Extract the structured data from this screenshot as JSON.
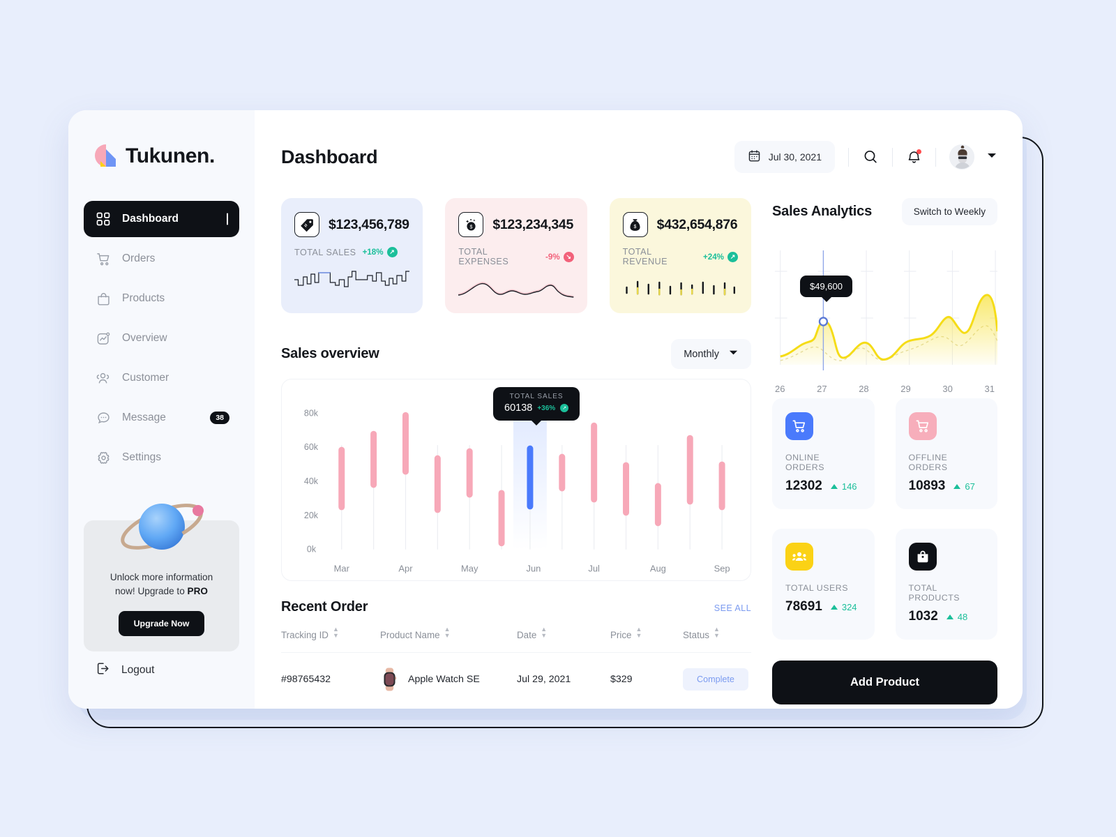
{
  "brand": {
    "name": "Tukunen."
  },
  "sidebar": {
    "items": [
      {
        "label": "Dashboard",
        "icon": "grid-icon",
        "active": true
      },
      {
        "label": "Orders",
        "icon": "cart-icon",
        "active": false
      },
      {
        "label": "Products",
        "icon": "bag-icon",
        "active": false
      },
      {
        "label": "Overview",
        "icon": "chart-icon",
        "active": false
      },
      {
        "label": "Customer",
        "icon": "users-icon",
        "active": false
      },
      {
        "label": "Message",
        "icon": "chat-icon",
        "active": false,
        "badge": "38"
      },
      {
        "label": "Settings",
        "icon": "gear-icon",
        "active": false
      }
    ],
    "promo": {
      "line1": "Unlock more information",
      "line2": "now! Upgrade to ",
      "bold": "PRO",
      "button": "Upgrade Now"
    },
    "logout": "Logout"
  },
  "header": {
    "title": "Dashboard",
    "date": "Jul 30, 2021",
    "search_icon": "search-icon",
    "bell_icon": "bell-icon"
  },
  "stats": [
    {
      "value": "$123,456,789",
      "label": "TOTAL SALES",
      "delta": "+18%",
      "dir": "up",
      "theme": "blue",
      "icon": "price-tag-icon"
    },
    {
      "value": "$123,234,345",
      "label": "TOTAL EXPENSES",
      "delta": "-9%",
      "dir": "down",
      "theme": "pink",
      "icon": "coin-sparkle-icon"
    },
    {
      "value": "$432,654,876",
      "label": "TOTAL REVENUE",
      "delta": "+24%",
      "dir": "up",
      "theme": "yellow",
      "icon": "money-bag-icon"
    }
  ],
  "sales_overview": {
    "title": "Sales overview",
    "period": "Monthly",
    "tooltip": {
      "label": "TOTAL SALES",
      "value": "60138",
      "delta": "+36%"
    }
  },
  "recent_order": {
    "title": "Recent Order",
    "see_all": "SEE ALL",
    "columns": [
      "Tracking ID",
      "Product Name",
      "Date",
      "Price",
      "Status"
    ],
    "rows": [
      {
        "tracking": "#98765432",
        "product": "Apple Watch SE",
        "date": "Jul 29, 2021",
        "price": "$329",
        "status": "Complete"
      }
    ]
  },
  "analytics": {
    "title": "Sales Analytics",
    "switch_label": "Switch to Weekly",
    "tooltip": "$49,600"
  },
  "metrics": [
    {
      "label": "ONLINE ORDERS",
      "value": "12302",
      "delta": "146",
      "color": "#4a7afc",
      "icon": "cart-icon"
    },
    {
      "label": "OFFLINE ORDERS",
      "value": "10893",
      "delta": "67",
      "color": "#f7aebb",
      "icon": "cart-icon"
    },
    {
      "label": "TOTAL USERS",
      "value": "78691",
      "delta": "324",
      "color": "#fbd215",
      "icon": "users-icon"
    },
    {
      "label": "TOTAL PRODUCTS",
      "value": "1032",
      "delta": "48",
      "color": "#0e1116",
      "icon": "bag-icon"
    }
  ],
  "add_product_button": "Add Product",
  "colors": {
    "accent_dark": "#0e1116",
    "bar_pink": "#f7a8b8",
    "bar_blue": "#4a7afc",
    "area_yellow": "#f5dc17",
    "positive": "#1bbf9a",
    "negative": "#f2617a",
    "link": "#7b9bf0",
    "page_bg": "#e8eefc"
  },
  "chart_data": [
    {
      "type": "bar",
      "title": "Sales overview",
      "subtype": "floating-range-bars",
      "xlabel": "",
      "ylabel": "",
      "ylim": [
        0,
        90000
      ],
      "ytick_labels": [
        "0k",
        "20k",
        "40k",
        "60k",
        "80k"
      ],
      "ytick_values": [
        0,
        20000,
        40000,
        60000,
        80000
      ],
      "categories": [
        "Mar",
        "",
        "Apr",
        "",
        "May",
        "",
        "Jun",
        "",
        "Jul",
        "",
        "Aug",
        "",
        "Sep"
      ],
      "axis_tick_labels": [
        "Mar",
        "Apr",
        "May",
        "Jun",
        "Jul",
        "Aug",
        "Sep"
      ],
      "grid": false,
      "legend": null,
      "bars": [
        {
          "label": "Mar",
          "low": 26000,
          "high": 60500,
          "color": "pink"
        },
        {
          "label": "Mar-2",
          "low": 39500,
          "high": 70500,
          "color": "pink"
        },
        {
          "label": "Apr",
          "low": 47500,
          "high": 82000,
          "color": "pink"
        },
        {
          "label": "Apr-2",
          "low": 24000,
          "high": 55500,
          "color": "pink"
        },
        {
          "label": "May",
          "low": 33500,
          "high": 60000,
          "color": "pink"
        },
        {
          "label": "May-2",
          "low": 4000,
          "high": 34500,
          "color": "pink"
        },
        {
          "label": "Jun",
          "low": 26500,
          "high": 61500,
          "color": "blue",
          "highlighted": true
        },
        {
          "label": "Jun-2",
          "low": 37500,
          "high": 56500,
          "color": "pink"
        },
        {
          "label": "Jul",
          "low": 30500,
          "high": 75500,
          "color": "pink"
        },
        {
          "label": "Jul-2",
          "low": 22500,
          "high": 51500,
          "color": "pink"
        },
        {
          "label": "Aug",
          "low": 16000,
          "high": 38500,
          "color": "pink"
        },
        {
          "label": "Aug-2",
          "low": 29500,
          "high": 68000,
          "color": "pink"
        },
        {
          "label": "Sep",
          "low": 26000,
          "high": 52000,
          "color": "pink"
        }
      ],
      "tooltip": {
        "label": "TOTAL SALES",
        "value": 60138,
        "delta": "+36%",
        "at_bar": "Jun"
      }
    },
    {
      "type": "area",
      "title": "Sales Analytics",
      "xlabel": "",
      "ylabel": "",
      "grid": true,
      "legend": null,
      "x": [
        26,
        27,
        28,
        29,
        30,
        31
      ],
      "xtick_labels": [
        "26",
        "27",
        "28",
        "29",
        "30",
        "31"
      ],
      "series": [
        {
          "name": "Sales",
          "color": "#f5dc17",
          "values": [
            12000,
            49600,
            24000,
            16000,
            41000,
            58000
          ]
        }
      ],
      "highlight": {
        "x": 27,
        "value": 49600,
        "label": "$49,600"
      }
    }
  ]
}
